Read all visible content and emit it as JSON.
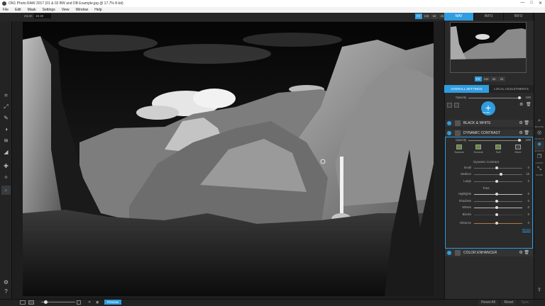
{
  "window": {
    "title": "ON1 Photo RAW 2017 (01 & 02 BW and DB Example.jpg @ 17.7% 8-bit)",
    "controls": [
      "—",
      "□",
      "✕"
    ]
  },
  "menu": [
    "File",
    "Edit",
    "Mask",
    "Settings",
    "View",
    "Window",
    "Help"
  ],
  "zoom": {
    "label": "Zoom",
    "value": "18.22",
    "buttons": [
      "FIT",
      "100",
      "50",
      "25"
    ],
    "active": 0
  },
  "nav_tabs": {
    "items": [
      "NAV",
      "INFO",
      "INFO"
    ],
    "active": 0
  },
  "thumb_zoom": {
    "buttons": [
      "FIT",
      "100",
      "50",
      "25"
    ],
    "active": 0
  },
  "section_tabs": {
    "items": [
      "OVERALL SETTINGS",
      "LOCAL ADJUSTMENTS"
    ],
    "active": 0
  },
  "opacity": {
    "label": "Opacity",
    "value": "100",
    "level": 1.0
  },
  "add_filter": {
    "label": "FILTER"
  },
  "filters": [
    {
      "name": "BLACK & WHITE"
    },
    {
      "name": "DYNAMIC CONTRAST"
    },
    {
      "name": "COLOR ENHANCER"
    }
  ],
  "dynamic_contrast": {
    "opacity": {
      "label": "Opacity",
      "value": "100",
      "level": 1.0
    },
    "presets": [
      "Natural",
      "Surreal",
      "Soft",
      "More"
    ],
    "section_title": "Dynamic Contrast",
    "sliders": [
      {
        "label": "Small",
        "value": "0",
        "level": 0.5
      },
      {
        "label": "Medium",
        "value": "15",
        "level": 0.58
      },
      {
        "label": "Large",
        "value": "0",
        "level": 0.5
      }
    ],
    "tone_title": "Tone",
    "tone_sliders": [
      {
        "label": "Highlights",
        "value": "0",
        "level": 0.5
      },
      {
        "label": "Shadows",
        "value": "0",
        "level": 0.5
      },
      {
        "label": "Whites",
        "value": "0",
        "level": 0.5
      },
      {
        "label": "Blacks",
        "value": "0",
        "level": 0.5
      },
      {
        "label": "Vibrance",
        "value": "0",
        "level": 0.5
      }
    ],
    "reset_label": "Reset"
  },
  "left_tools": [
    {
      "icon": "crop-icon",
      "glyph": "⌗",
      "label": "CROP"
    },
    {
      "icon": "transform-icon",
      "glyph": "⤢",
      "label": "TRANSFORM"
    },
    {
      "icon": "brush-icon",
      "glyph": "✎",
      "label": "BRUSH"
    },
    {
      "icon": "mask-icon",
      "glyph": "◑",
      "label": "MASK"
    },
    {
      "icon": "refine-icon",
      "glyph": "≋",
      "label": "REFINE"
    },
    {
      "icon": "chisel-icon",
      "glyph": "◢",
      "label": "CHISEL"
    },
    {
      "icon": "retouch-icon",
      "glyph": "✚",
      "label": "RETOUCH"
    },
    {
      "icon": "clone-icon",
      "glyph": "✧",
      "label": "CLONE"
    },
    {
      "icon": "view-icon",
      "glyph": "⌕",
      "label": "VIEW"
    }
  ],
  "right_tools": [
    {
      "icon": "browse-icon",
      "glyph": "⌕",
      "label": "BROWSE"
    },
    {
      "icon": "develop-icon",
      "glyph": "◎",
      "label": "DEVELOP"
    },
    {
      "icon": "effects-icon",
      "glyph": "✺",
      "label": "EFFECTS"
    },
    {
      "icon": "layers-icon",
      "glyph": "❐",
      "label": "LAYERS"
    },
    {
      "icon": "resize-icon",
      "glyph": "⤡",
      "label": "RESIZE"
    }
  ],
  "bottom": {
    "preview_label": "Preview",
    "reset_all": "Reset All",
    "reset": "Reset",
    "sync": "Sync"
  },
  "colors": {
    "accent": "#2f9de0"
  }
}
